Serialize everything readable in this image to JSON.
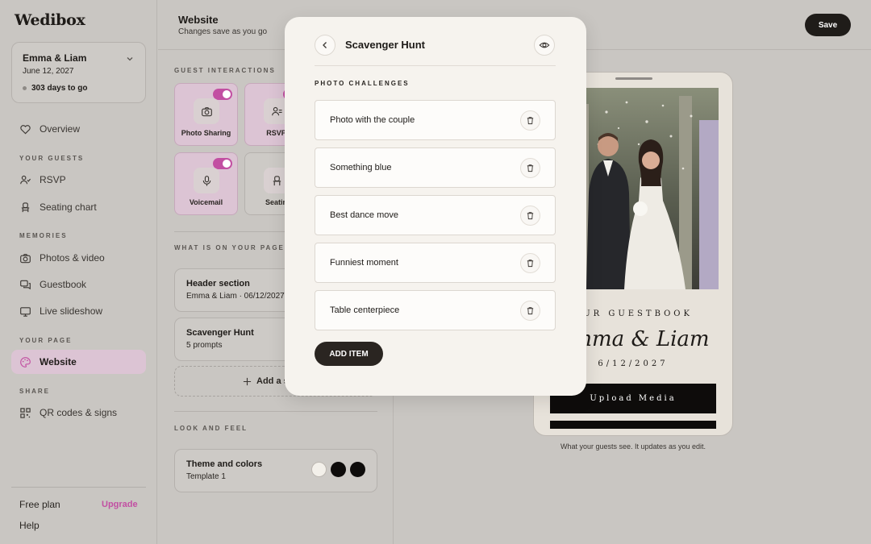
{
  "app": {
    "logo": "Wedibox"
  },
  "event": {
    "name": "Emma & Liam",
    "date": "June 12, 2027",
    "countdown": "303 days to go"
  },
  "nav": {
    "overview": "Overview",
    "section_guests": "YOUR GUESTS",
    "rsvp": "RSVP",
    "seating": "Seating chart",
    "section_memories": "MEMORIES",
    "photos": "Photos & video",
    "guestbook": "Guestbook",
    "slideshow": "Live slideshow",
    "section_page": "YOUR PAGE",
    "website": "Website",
    "section_share": "SHARE",
    "qr": "QR codes & signs"
  },
  "plan": {
    "label": "Free plan",
    "upgrade": "Upgrade",
    "help": "Help"
  },
  "header": {
    "title": "Website",
    "subtitle": "Changes save as you go",
    "save": "Save"
  },
  "editor": {
    "section_interactions": "GUEST INTERACTIONS",
    "tiles": [
      {
        "label": "Photo Sharing",
        "icon": "camera-icon",
        "enabled": true
      },
      {
        "label": "RSVP",
        "icon": "rsvp-icon",
        "enabled": true
      },
      {
        "label": "Voicemail",
        "icon": "microphone-icon",
        "enabled": true
      },
      {
        "label": "Seatin",
        "icon": "chair-icon",
        "enabled": false
      }
    ],
    "section_page": "WHAT IS ON YOUR PAGE",
    "header_section": {
      "title": "Header section",
      "sub": "Emma & Liam · 06/12/2027"
    },
    "hunt_section": {
      "title": "Scavenger Hunt",
      "sub": "5 prompts"
    },
    "add_section": "Add a s",
    "section_look": "LOOK AND FEEL",
    "theme": {
      "title": "Theme and colors",
      "sub": "Template 1"
    },
    "swatches": [
      "#f3f0ea",
      "#0e0c0b",
      "#0e0c0b"
    ]
  },
  "modal": {
    "title": "Scavenger Hunt",
    "section": "PHOTO CHALLENGES",
    "items": [
      "Photo with the couple",
      "Something blue",
      "Best dance move",
      "Funniest moment",
      "Table centerpiece"
    ],
    "add_item": "ADD ITEM"
  },
  "preview": {
    "guestbook_label": "OUR GUESTBOOK",
    "couple": "Emma & Liam",
    "date": "6/12/2027",
    "upload": "Upload Media",
    "caption": "What your guests see. It updates as you edit."
  },
  "colors": {
    "accent": "#c24fa2",
    "active_bg": "#dcc4d4",
    "dark": "#1f1c19"
  }
}
